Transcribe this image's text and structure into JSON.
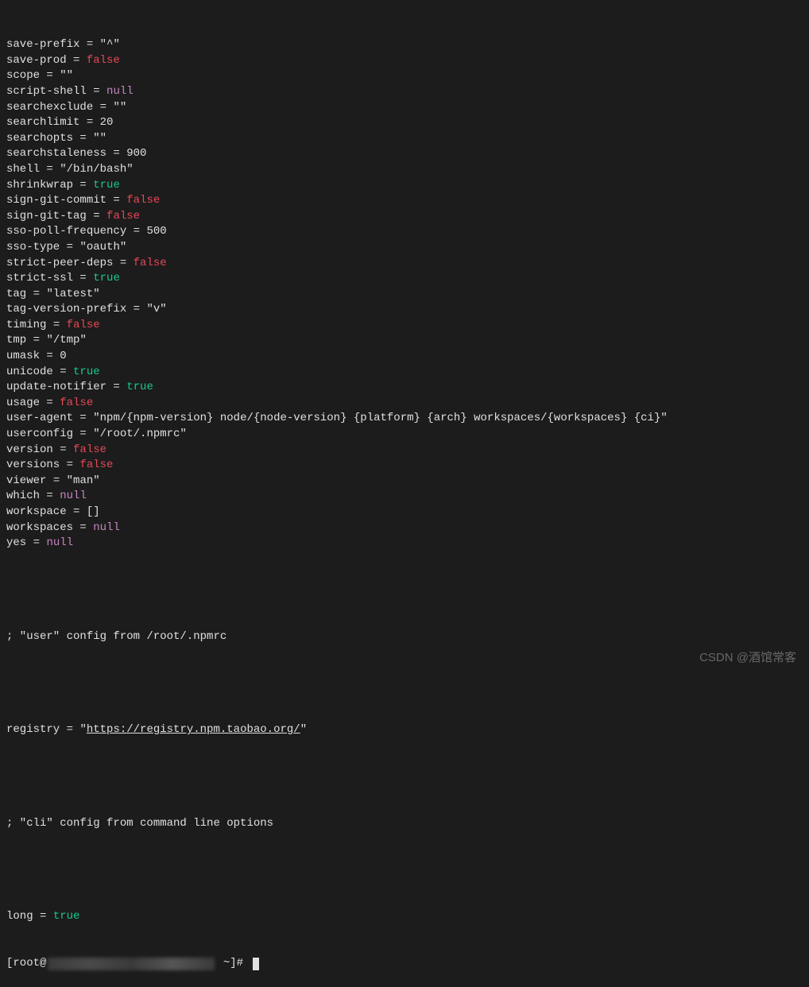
{
  "config_lines": [
    {
      "key": "save-prefix",
      "type": "string",
      "value": "\"^\""
    },
    {
      "key": "save-prod",
      "type": "false",
      "value": "false"
    },
    {
      "key": "scope",
      "type": "string",
      "value": "\"\""
    },
    {
      "key": "script-shell",
      "type": "null",
      "value": "null"
    },
    {
      "key": "searchexclude",
      "type": "string",
      "value": "\"\""
    },
    {
      "key": "searchlimit",
      "type": "number",
      "value": "20"
    },
    {
      "key": "searchopts",
      "type": "string",
      "value": "\"\""
    },
    {
      "key": "searchstaleness",
      "type": "number",
      "value": "900"
    },
    {
      "key": "shell",
      "type": "string",
      "value": "\"/bin/bash\""
    },
    {
      "key": "shrinkwrap",
      "type": "true",
      "value": "true"
    },
    {
      "key": "sign-git-commit",
      "type": "false",
      "value": "false"
    },
    {
      "key": "sign-git-tag",
      "type": "false",
      "value": "false"
    },
    {
      "key": "sso-poll-frequency",
      "type": "number",
      "value": "500"
    },
    {
      "key": "sso-type",
      "type": "string",
      "value": "\"oauth\""
    },
    {
      "key": "strict-peer-deps",
      "type": "false",
      "value": "false"
    },
    {
      "key": "strict-ssl",
      "type": "true",
      "value": "true"
    },
    {
      "key": "tag",
      "type": "string",
      "value": "\"latest\""
    },
    {
      "key": "tag-version-prefix",
      "type": "string",
      "value": "\"v\""
    },
    {
      "key": "timing",
      "type": "false",
      "value": "false"
    },
    {
      "key": "tmp",
      "type": "string",
      "value": "\"/tmp\""
    },
    {
      "key": "umask",
      "type": "number",
      "value": "0"
    },
    {
      "key": "unicode",
      "type": "true",
      "value": "true"
    },
    {
      "key": "update-notifier",
      "type": "true",
      "value": "true"
    },
    {
      "key": "usage",
      "type": "false",
      "value": "false"
    },
    {
      "key": "user-agent",
      "type": "string",
      "value": "\"npm/{npm-version} node/{node-version} {platform} {arch} workspaces/{workspaces} {ci}\""
    },
    {
      "key": "userconfig",
      "type": "string",
      "value": "\"/root/.npmrc\""
    },
    {
      "key": "version",
      "type": "false",
      "value": "false"
    },
    {
      "key": "versions",
      "type": "false",
      "value": "false"
    },
    {
      "key": "viewer",
      "type": "string",
      "value": "\"man\""
    },
    {
      "key": "which",
      "type": "null",
      "value": "null"
    },
    {
      "key": "workspace",
      "type": "number",
      "value": "[]"
    },
    {
      "key": "workspaces",
      "type": "null",
      "value": "null"
    },
    {
      "key": "yes",
      "type": "null",
      "value": "null"
    }
  ],
  "comment_user": "; \"user\" config from /root/.npmrc",
  "registry_line": {
    "key": "registry",
    "value": "https://registry.npm.taobao.org/"
  },
  "comment_cli": "; \"cli\" config from command line options",
  "long_line": {
    "key": "long",
    "type": "true",
    "value": "true"
  },
  "prompt": {
    "prefix": "[root@",
    "suffix": " ~]# "
  },
  "watermark": "CSDN @酒馆常客"
}
